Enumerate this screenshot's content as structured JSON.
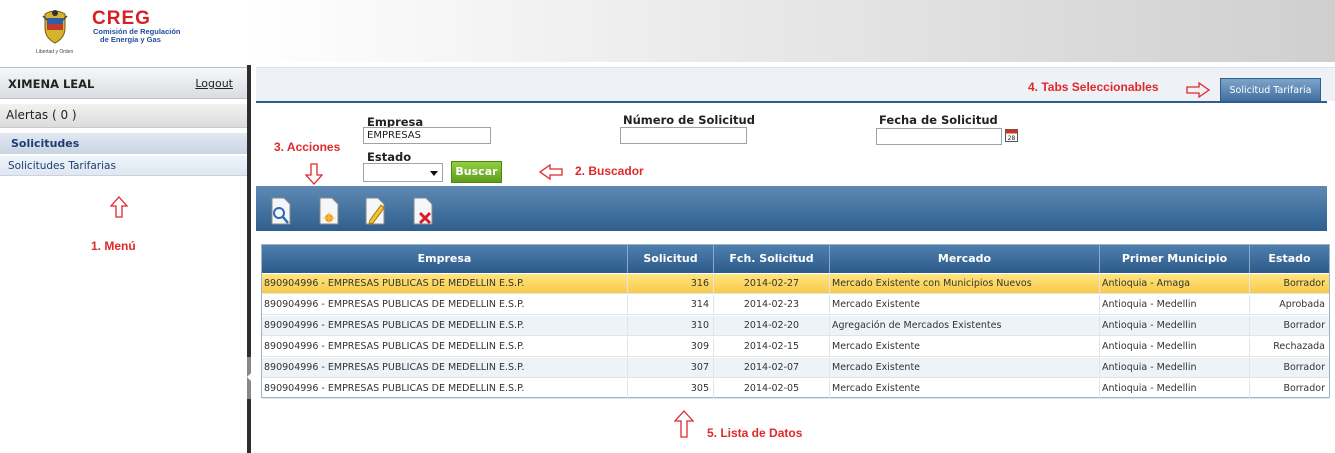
{
  "header": {
    "logo_text": "CREG",
    "logo_line1": "Comisión de Regulación",
    "logo_line2": "de Energía y Gas",
    "motto": "Libertad y Orden"
  },
  "sidebar": {
    "user": "XIMENA LEAL",
    "logout": "Logout",
    "alerts": "Alertas ( 0 )",
    "section": "Solicitudes",
    "item": "Solicitudes Tarifarias"
  },
  "annotations": {
    "menu": "1. Menú",
    "buscador": "2. Buscador",
    "acciones": "3. Acciones",
    "tabs": "4. Tabs Seleccionables",
    "lista": "5. Lista de Datos"
  },
  "tab": {
    "label": "Solicitud Tarifaria"
  },
  "search": {
    "empresa_label": "Empresa",
    "empresa_value": "EMPRESAS",
    "estado_label": "Estado",
    "numero_label": "Número de Solicitud",
    "fecha_label": "Fecha de Solicitud",
    "buscar": "Buscar"
  },
  "toolbar": {
    "icons": [
      "view-icon",
      "new-icon",
      "edit-icon",
      "delete-icon"
    ]
  },
  "table": {
    "columns": [
      "Empresa",
      "Solicitud",
      "Fch. Solicitud",
      "Mercado",
      "Primer Municipio",
      "Estado"
    ],
    "rows": [
      [
        "890904996 - EMPRESAS PUBLICAS DE MEDELLIN E.S.P.",
        "316",
        "2014-02-27",
        "Mercado Existente con Municipios Nuevos",
        "Antioquia - Amaga",
        "Borrador"
      ],
      [
        "890904996 - EMPRESAS PUBLICAS DE MEDELLIN E.S.P.",
        "314",
        "2014-02-23",
        "Mercado Existente",
        "Antioquia - Medellin",
        "Aprobada"
      ],
      [
        "890904996 - EMPRESAS PUBLICAS DE MEDELLIN E.S.P.",
        "310",
        "2014-02-20",
        "Agregación de Mercados Existentes",
        "Antioquia - Medellin",
        "Borrador"
      ],
      [
        "890904996 - EMPRESAS PUBLICAS DE MEDELLIN E.S.P.",
        "309",
        "2014-02-15",
        "Mercado Existente",
        "Antioquia - Medellin",
        "Rechazada"
      ],
      [
        "890904996 - EMPRESAS PUBLICAS DE MEDELLIN E.S.P.",
        "307",
        "2014-02-07",
        "Mercado Existente",
        "Antioquia - Medellin",
        "Borrador"
      ],
      [
        "890904996 - EMPRESAS PUBLICAS DE MEDELLIN E.S.P.",
        "305",
        "2014-02-05",
        "Mercado Existente",
        "Antioquia - Medellin",
        "Borrador"
      ]
    ]
  },
  "colors": {
    "accent": "#2c5f8e",
    "annotation": "#e0282a",
    "selected_row": "#f8c94a",
    "buscar": "#6aab24"
  }
}
